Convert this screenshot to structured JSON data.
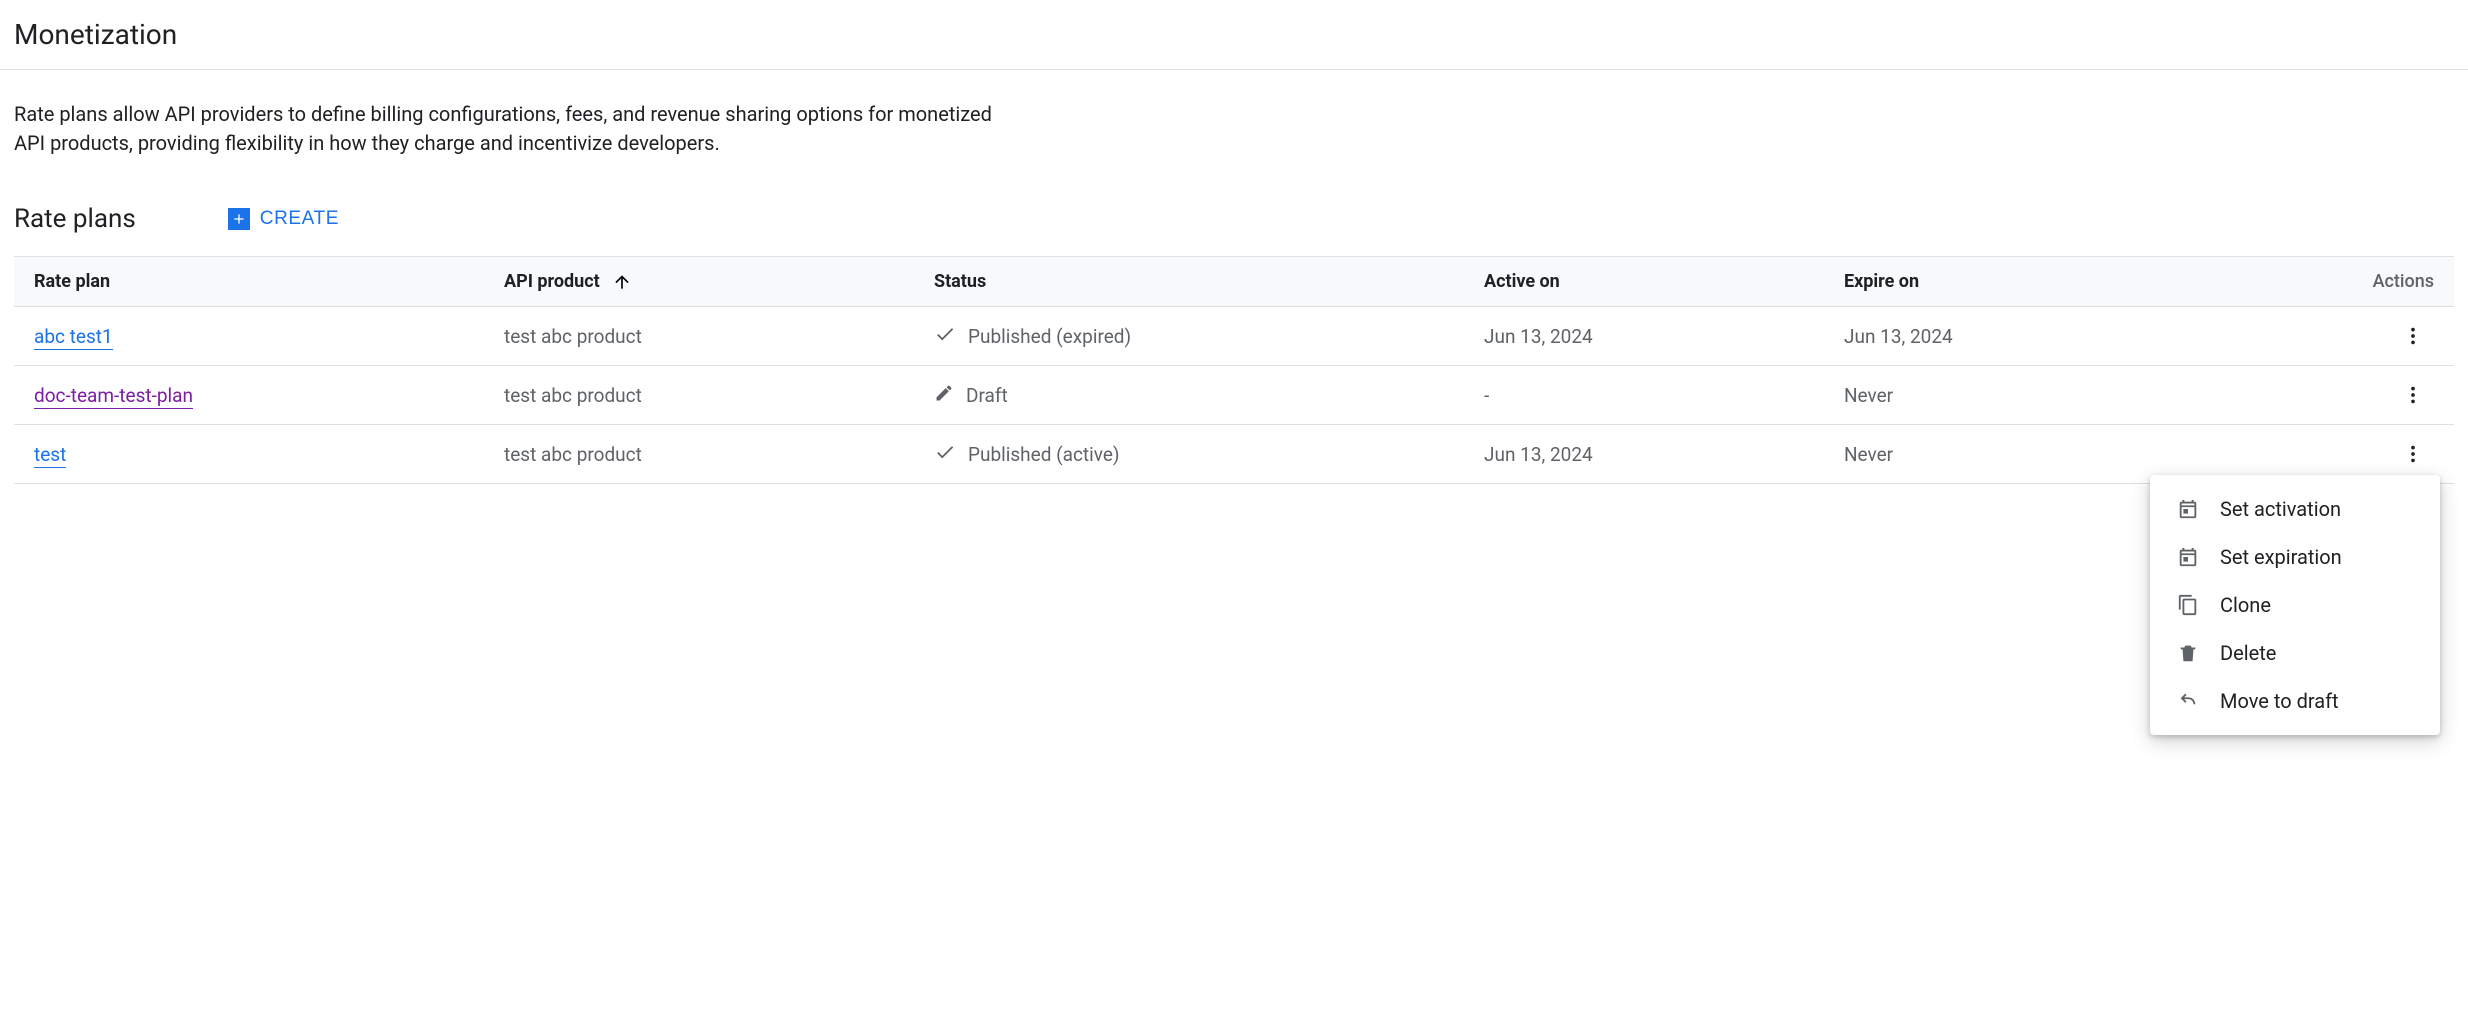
{
  "page_title": "Monetization",
  "description": "Rate plans allow API providers to define billing configurations, fees, and revenue sharing options for monetized API products, providing flexibility in how they charge and incentivize developers.",
  "section_title": "Rate plans",
  "create_label": "CREATE",
  "table": {
    "columns": {
      "name": "Rate plan",
      "product": "API product",
      "status": "Status",
      "active_on": "Active on",
      "expire_on": "Expire on",
      "actions": "Actions"
    },
    "sort": {
      "column": "product",
      "direction": "asc"
    },
    "rows": [
      {
        "name": "abc test1",
        "visited": false,
        "product": "test abc product",
        "status_icon": "check",
        "status": "Published (expired)",
        "active_on": "Jun 13, 2024",
        "expire_on": "Jun 13, 2024"
      },
      {
        "name": "doc-team-test-plan",
        "visited": true,
        "product": "test abc product",
        "status_icon": "pencil",
        "status": "Draft",
        "active_on": "-",
        "expire_on": "Never"
      },
      {
        "name": "test",
        "visited": false,
        "product": "test abc product",
        "status_icon": "check",
        "status": "Published (active)",
        "active_on": "Jun 13, 2024",
        "expire_on": "Never"
      }
    ]
  },
  "actions_menu": {
    "open_for_row": 2,
    "items": [
      {
        "icon": "calendar",
        "label": "Set activation"
      },
      {
        "icon": "calendar",
        "label": "Set expiration"
      },
      {
        "icon": "copy",
        "label": "Clone"
      },
      {
        "icon": "trash",
        "label": "Delete"
      },
      {
        "icon": "undo",
        "label": "Move to draft"
      }
    ]
  }
}
